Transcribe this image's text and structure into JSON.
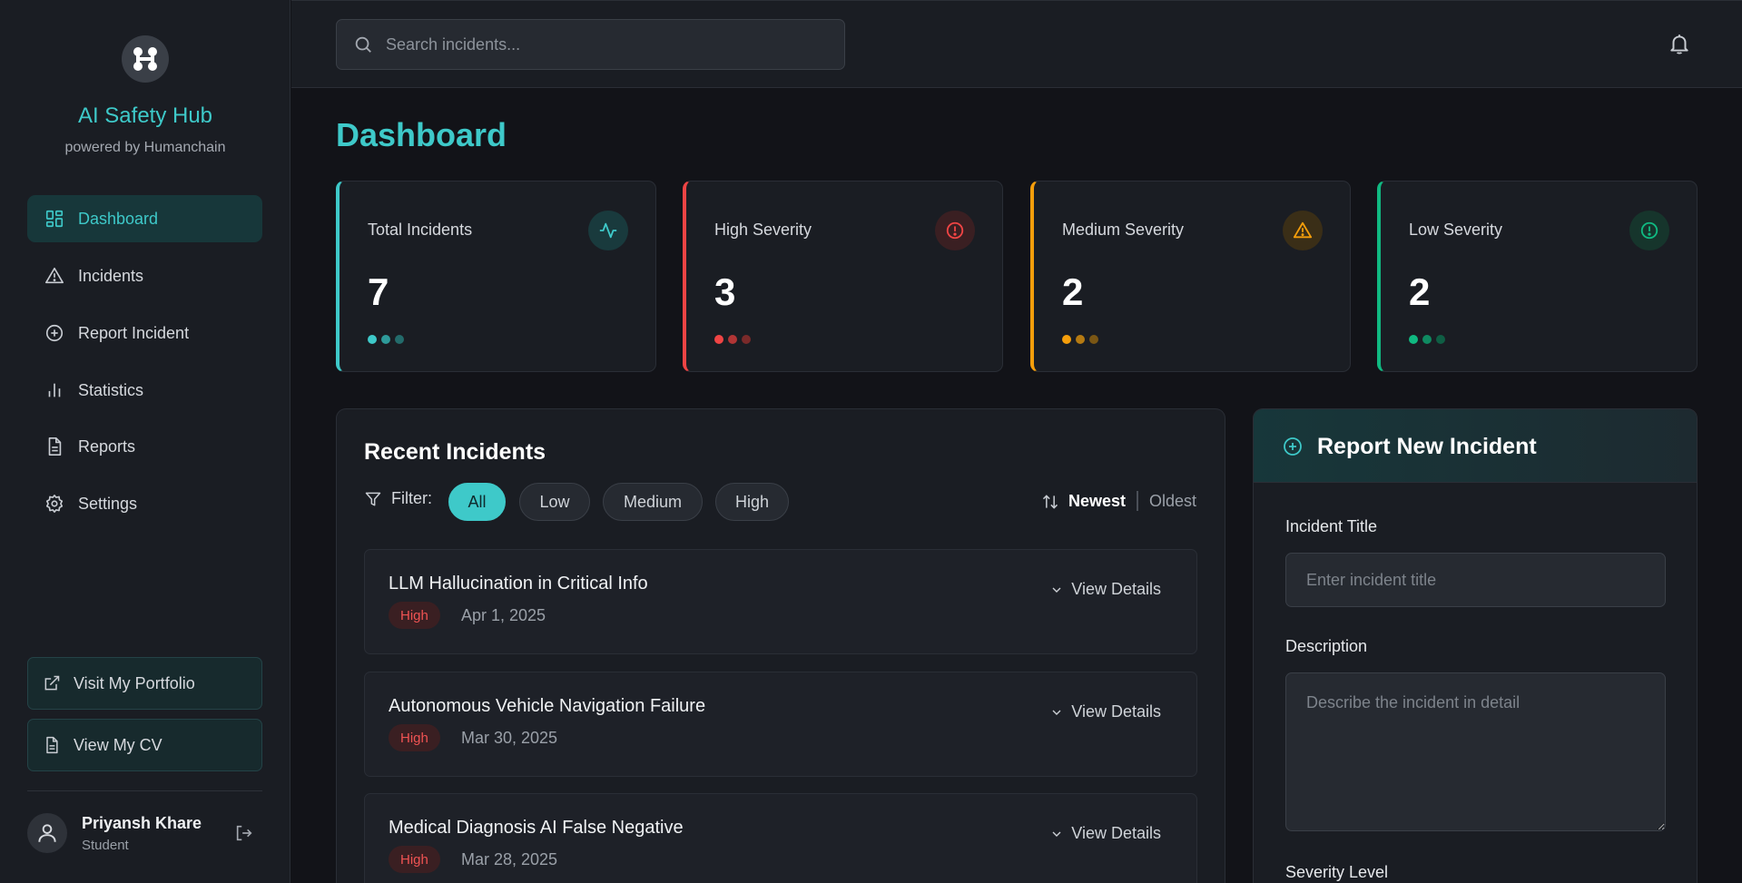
{
  "brand": {
    "title": "AI Safety Hub",
    "subtitle": "powered by Humanchain"
  },
  "sidebar": {
    "items": [
      {
        "label": "Dashboard",
        "icon": "dashboard-icon",
        "active": true
      },
      {
        "label": "Incidents",
        "icon": "warning-triangle-icon"
      },
      {
        "label": "Report Incident",
        "icon": "plus-circle-icon"
      },
      {
        "label": "Statistics",
        "icon": "bar-chart-icon"
      },
      {
        "label": "Reports",
        "icon": "document-icon"
      },
      {
        "label": "Settings",
        "icon": "gear-icon"
      }
    ],
    "portfolio_label": "Visit My Portfolio",
    "cv_label": "View My CV"
  },
  "user": {
    "name": "Priyansh Khare",
    "role": "Student"
  },
  "search": {
    "placeholder": "Search incidents..."
  },
  "page": {
    "title": "Dashboard"
  },
  "stats": [
    {
      "label": "Total Incidents",
      "value": "7",
      "color": "#3ec9c9",
      "icon": "activity-icon"
    },
    {
      "label": "High Severity",
      "value": "3",
      "color": "#ef4444",
      "icon": "alert-circle-icon"
    },
    {
      "label": "Medium Severity",
      "value": "2",
      "color": "#f59e0b",
      "icon": "alert-triangle-icon"
    },
    {
      "label": "Low Severity",
      "value": "2",
      "color": "#10b981",
      "icon": "info-circle-icon"
    }
  ],
  "recent": {
    "title": "Recent Incidents",
    "filter_label": "Filter:",
    "filters": [
      "All",
      "Low",
      "Medium",
      "High"
    ],
    "active_filter": "All",
    "sort_newest": "Newest",
    "sort_oldest": "Oldest",
    "view_details_label": "View Details",
    "incidents": [
      {
        "title": "LLM Hallucination in Critical Info",
        "severity": "High",
        "date": "Apr 1, 2025"
      },
      {
        "title": "Autonomous Vehicle Navigation Failure",
        "severity": "High",
        "date": "Mar 30, 2025"
      },
      {
        "title": "Medical Diagnosis AI False Negative",
        "severity": "High",
        "date": "Mar 28, 2025"
      }
    ]
  },
  "report": {
    "title": "Report New Incident",
    "title_label": "Incident Title",
    "title_placeholder": "Enter incident title",
    "description_label": "Description",
    "description_placeholder": "Describe the incident in detail",
    "severity_label": "Severity Level"
  }
}
